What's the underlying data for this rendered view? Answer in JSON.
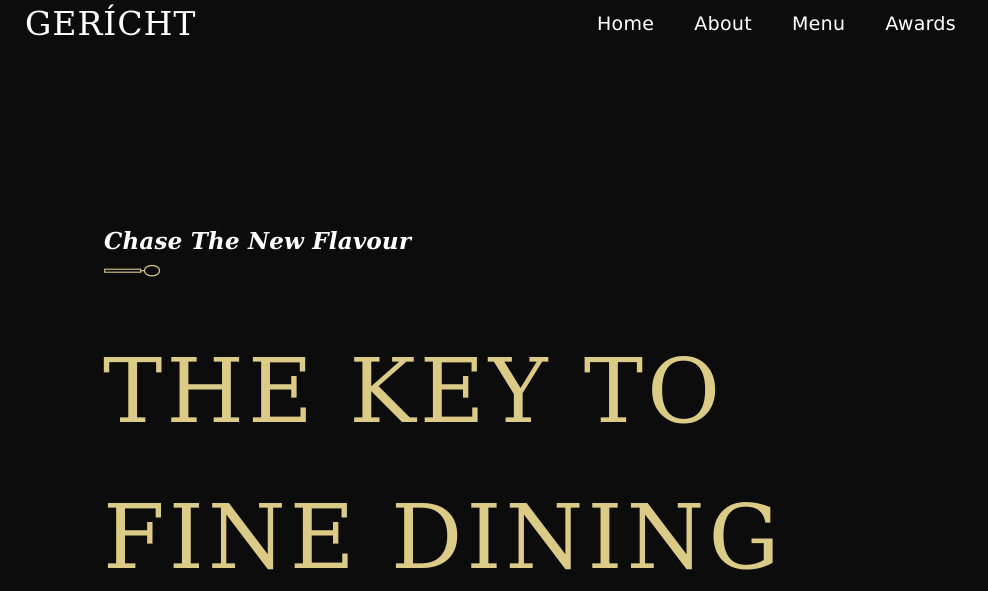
{
  "nav": {
    "logo": "GERÍCHT",
    "links": [
      "Home",
      "About",
      "Menu",
      "Awards"
    ]
  },
  "hero": {
    "subtitle": "Chase The New Flavour",
    "headline_line1": "THE KEY TO",
    "headline_line2": "FINE DINING"
  },
  "colors": {
    "background": "#0c0c0c",
    "accent_gold": "#dcca87",
    "text": "#ffffff"
  },
  "icons": {
    "divider": "spoon-icon"
  }
}
